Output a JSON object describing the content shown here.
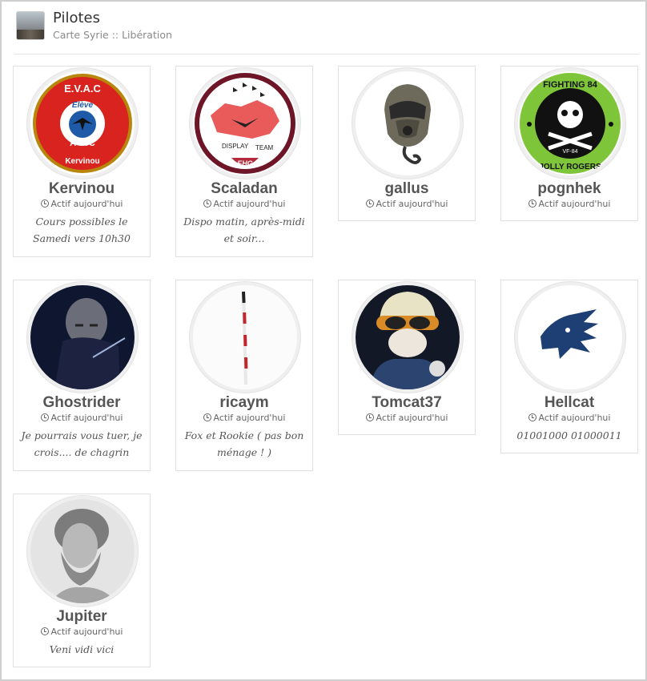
{
  "header": {
    "title": "Pilotes",
    "subtitle": "Carte Syrie :: Libération",
    "thumbnail_icon": "landscape-thumbnail-icon"
  },
  "status_icon": "clock-icon",
  "pilots": [
    {
      "name": "Kervinou",
      "status": "Actif aujourd'hui",
      "motto": "Cours possibles le Samedi vers 10h30",
      "avatar_icon": "evac-a10c-badge",
      "avatar_text_top": "E.V.A.C",
      "avatar_text_mid": "Elève",
      "avatar_text_model": "A-10C",
      "avatar_text_bottom": "Kervinou"
    },
    {
      "name": "Scaladan",
      "status": "Actif aujourd'hui",
      "motto": "Dispo matin, après-midi et soir...",
      "avatar_icon": "display-team-patch",
      "avatar_text_left": "DISPLAY",
      "avatar_text_right": "TEAM",
      "avatar_text_bottom": "EHG"
    },
    {
      "name": "gallus",
      "status": "Actif aujourd'hui",
      "motto": "",
      "avatar_icon": "pilot-helmet-avatar"
    },
    {
      "name": "pognhek",
      "status": "Actif aujourd'hui",
      "motto": "",
      "avatar_icon": "jolly-rogers-patch",
      "avatar_text_top": "FIGHTING 84",
      "avatar_text_mid": "VF-84",
      "avatar_text_bottom": "JOLLY ROGERS"
    },
    {
      "name": "Ghostrider",
      "status": "Actif aujourd'hui",
      "motto": "Je pourrais vous tuer, je crois.... de chagrin",
      "avatar_icon": "dark-portrait-avatar"
    },
    {
      "name": "ricaym",
      "status": "Actif aujourd'hui",
      "motto": "Fox et Rookie ( pas bon ménage ! )",
      "avatar_icon": "white-cane-avatar"
    },
    {
      "name": "Tomcat37",
      "status": "Actif aujourd'hui",
      "motto": "",
      "avatar_icon": "tomcat-pilot-avatar"
    },
    {
      "name": "Hellcat",
      "status": "Actif aujourd'hui",
      "motto": "01001000 01000011",
      "avatar_icon": "blue-wolf-avatar"
    },
    {
      "name": "Jupiter",
      "status": "Actif aujourd'hui",
      "motto": "Veni vidi vici",
      "avatar_icon": "jupiter-bust-avatar"
    }
  ]
}
